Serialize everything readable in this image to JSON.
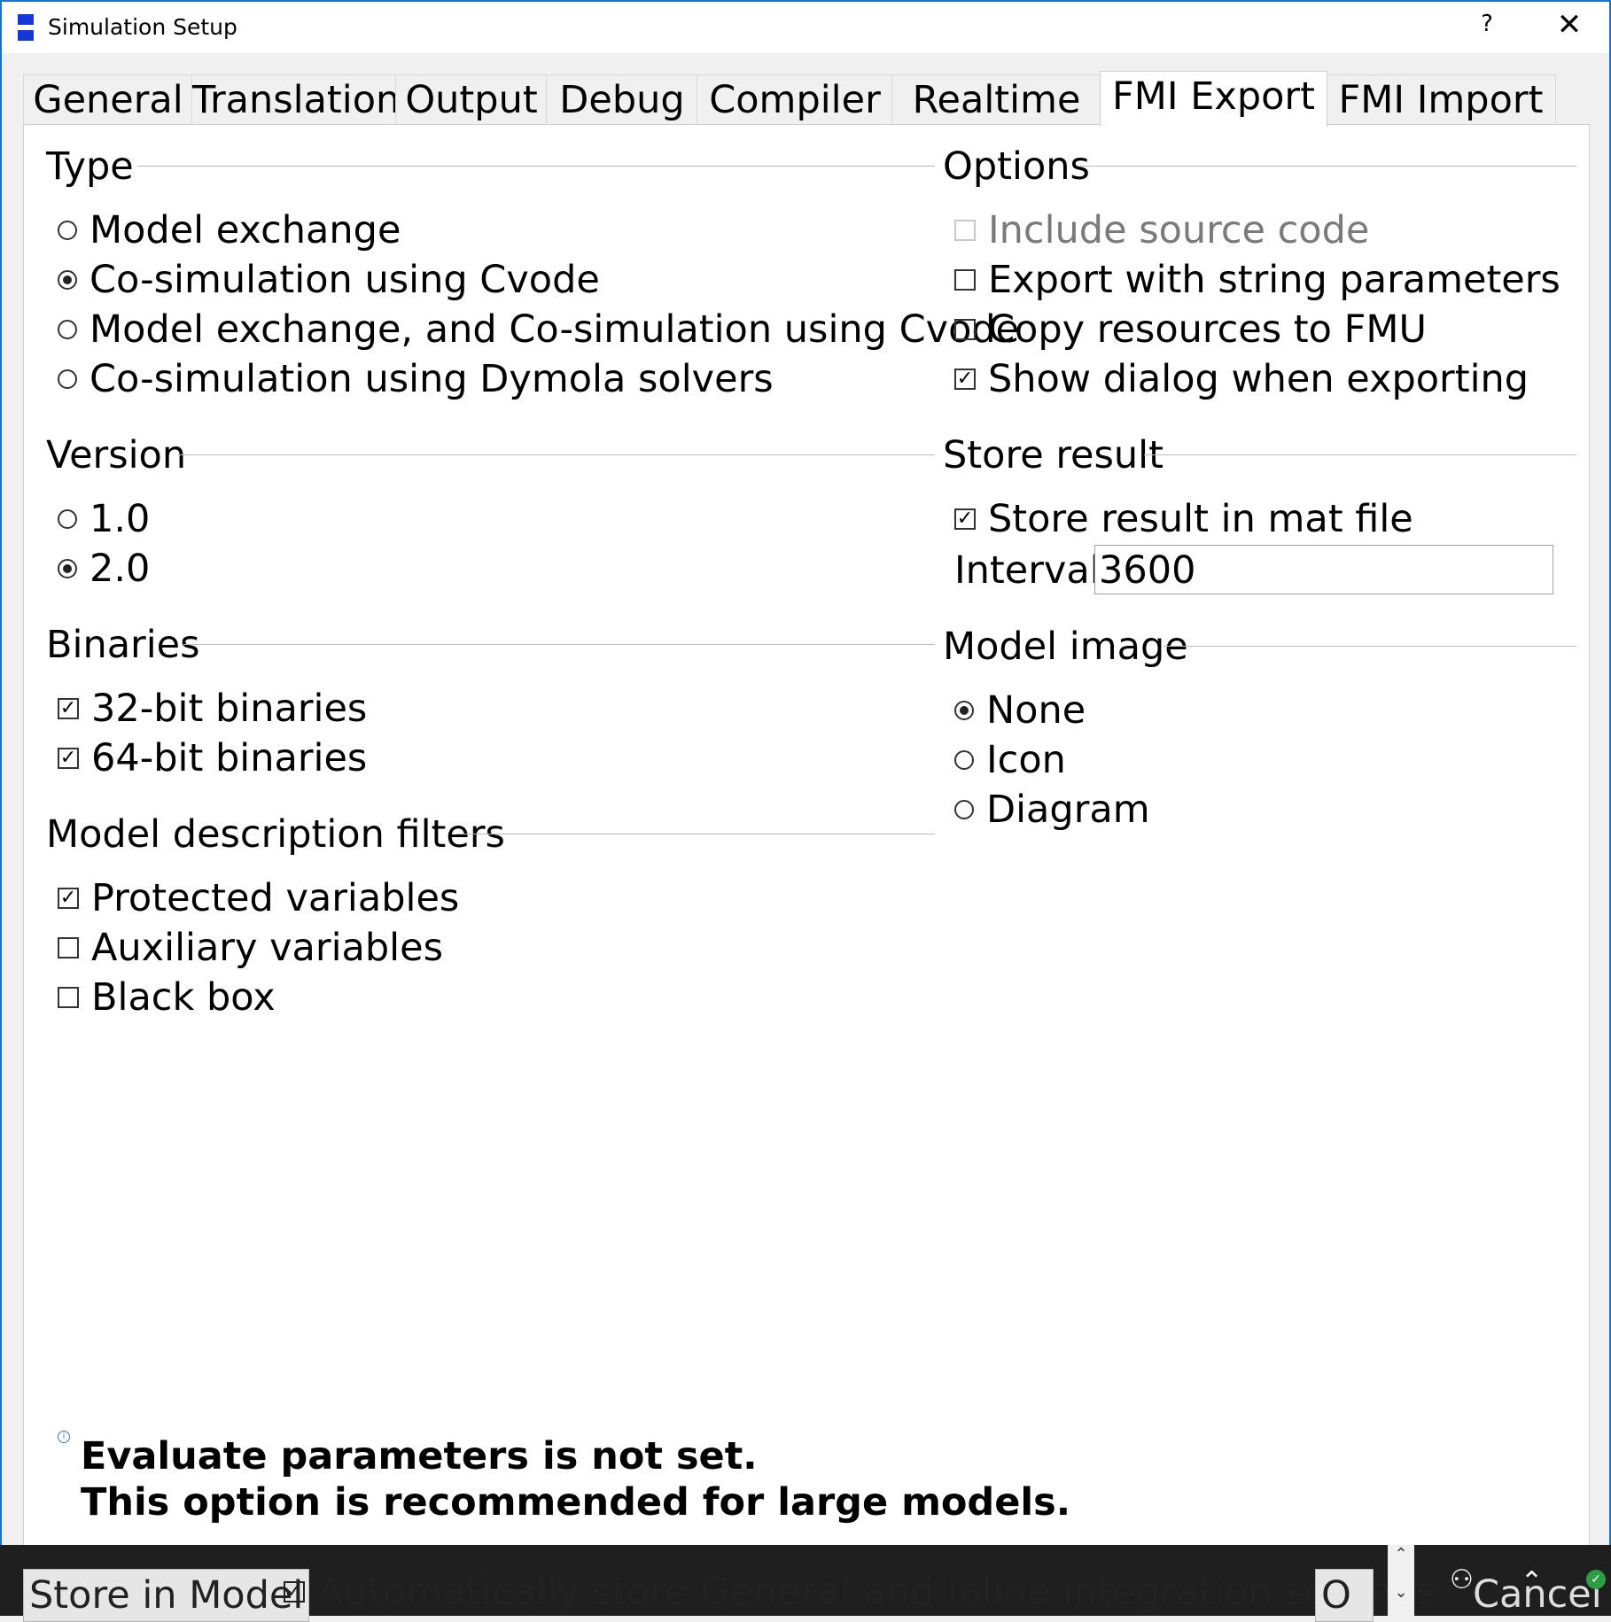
{
  "window": {
    "title": "Simulation Setup",
    "help": "?",
    "close": "✕"
  },
  "tabs": [
    {
      "label": "General",
      "active": false
    },
    {
      "label": "Translation",
      "active": false
    },
    {
      "label": "Output",
      "active": false
    },
    {
      "label": "Debug",
      "active": false
    },
    {
      "label": "Compiler",
      "active": false
    },
    {
      "label": "Realtime",
      "active": false
    },
    {
      "label": "FMI Export",
      "active": true
    },
    {
      "label": "FMI Import",
      "active": false
    }
  ],
  "type": {
    "title": "Type",
    "options": [
      {
        "label": "Model exchange",
        "selected": false
      },
      {
        "label": "Co-simulation using Cvode",
        "selected": true
      },
      {
        "label": "Model exchange, and Co-simulation using Cvode",
        "selected": false
      },
      {
        "label": "Co-simulation using Dymola solvers",
        "selected": false
      }
    ]
  },
  "version": {
    "title": "Version",
    "options": [
      {
        "label": "1.0",
        "selected": false
      },
      {
        "label": "2.0",
        "selected": true
      }
    ]
  },
  "binaries": {
    "title": "Binaries",
    "items": [
      {
        "label": "32-bit binaries",
        "checked": true
      },
      {
        "label": "64-bit binaries",
        "checked": true
      }
    ]
  },
  "filters": {
    "title": "Model description filters",
    "items": [
      {
        "label": "Protected variables",
        "checked": true
      },
      {
        "label": "Auxiliary variables",
        "checked": false
      },
      {
        "label": "Black box",
        "checked": false
      }
    ]
  },
  "options": {
    "title": "Options",
    "items": [
      {
        "label": "Include source code",
        "checked": false,
        "disabled": true
      },
      {
        "label": "Export with string parameters",
        "checked": false,
        "disabled": false
      },
      {
        "label": "Copy resources to FMU",
        "checked": false,
        "disabled": false
      },
      {
        "label": "Show dialog when exporting",
        "checked": true,
        "disabled": false
      }
    ]
  },
  "store_result": {
    "title": "Store result",
    "checkbox_label": "Store result in mat file",
    "checked": true,
    "interval_label": "Interval",
    "interval_value": "3600"
  },
  "model_image": {
    "title": "Model image",
    "options": [
      {
        "label": "None",
        "selected": true
      },
      {
        "label": "Icon",
        "selected": false
      },
      {
        "label": "Diagram",
        "selected": false
      }
    ]
  },
  "message": {
    "line1": "Evaluate parameters is not set.",
    "line2": "This option is recommended for large models."
  },
  "bottom": {
    "store_in_model": "Store in Model",
    "auto_store_label": "Automatically store General and Inline integration settings",
    "ok": "O",
    "cancel": "Cancel"
  },
  "colors": {
    "accent": "#1a73c8",
    "icon_blue": "#1537d8"
  }
}
